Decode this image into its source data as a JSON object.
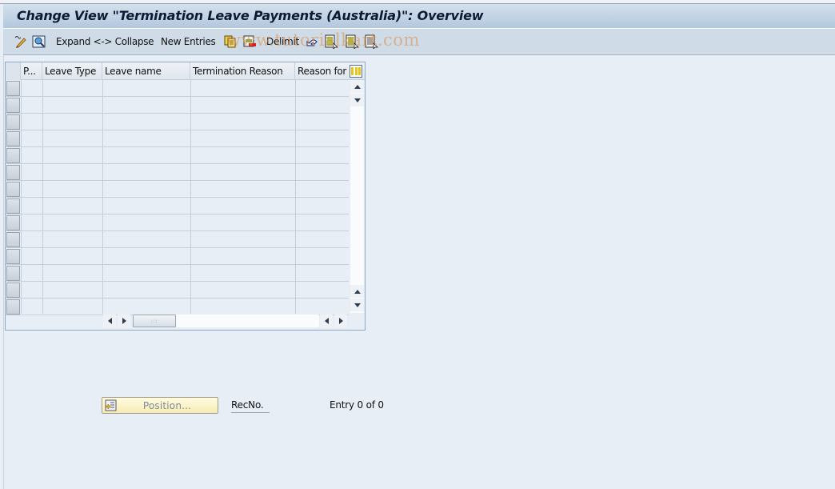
{
  "window": {
    "title": "Change View \"Termination Leave Payments (Australia)\": Overview"
  },
  "toolbar": {
    "items": [
      {
        "type": "icon",
        "name": "display-change-icon",
        "label": ""
      },
      {
        "type": "icon",
        "name": "find-icon",
        "label": ""
      },
      {
        "type": "text",
        "name": "expand-collapse-button",
        "label": "Expand <-> Collapse"
      },
      {
        "type": "text",
        "name": "new-entries-button",
        "label": "New Entries"
      },
      {
        "type": "icon",
        "name": "copy-as-icon",
        "label": ""
      },
      {
        "type": "icon",
        "name": "delete-icon",
        "label": ""
      },
      {
        "type": "text",
        "name": "delimit-button",
        "label": "Delimit"
      },
      {
        "type": "icon",
        "name": "undo-change-icon",
        "label": ""
      },
      {
        "type": "icon",
        "name": "select-all-icon",
        "label": ""
      },
      {
        "type": "icon",
        "name": "select-block-icon",
        "label": ""
      },
      {
        "type": "icon",
        "name": "deselect-all-icon",
        "label": ""
      }
    ],
    "watermark": "www.tutorialkart.com"
  },
  "table": {
    "columns": [
      {
        "key": "p",
        "label": "P..."
      },
      {
        "key": "leave_type",
        "label": "Leave Type"
      },
      {
        "key": "leave_name",
        "label": "Leave name"
      },
      {
        "key": "termination_reason",
        "label": "Termination Reason"
      },
      {
        "key": "reason_for",
        "label": "Reason for a"
      }
    ],
    "rows": [
      {
        "p": "",
        "leave_type": "",
        "leave_name": "",
        "termination_reason": "",
        "reason_for": ""
      },
      {
        "p": "",
        "leave_type": "",
        "leave_name": "",
        "termination_reason": "",
        "reason_for": ""
      },
      {
        "p": "",
        "leave_type": "",
        "leave_name": "",
        "termination_reason": "",
        "reason_for": ""
      },
      {
        "p": "",
        "leave_type": "",
        "leave_name": "",
        "termination_reason": "",
        "reason_for": ""
      },
      {
        "p": "",
        "leave_type": "",
        "leave_name": "",
        "termination_reason": "",
        "reason_for": ""
      },
      {
        "p": "",
        "leave_type": "",
        "leave_name": "",
        "termination_reason": "",
        "reason_for": ""
      },
      {
        "p": "",
        "leave_type": "",
        "leave_name": "",
        "termination_reason": "",
        "reason_for": ""
      },
      {
        "p": "",
        "leave_type": "",
        "leave_name": "",
        "termination_reason": "",
        "reason_for": ""
      },
      {
        "p": "",
        "leave_type": "",
        "leave_name": "",
        "termination_reason": "",
        "reason_for": ""
      },
      {
        "p": "",
        "leave_type": "",
        "leave_name": "",
        "termination_reason": "",
        "reason_for": ""
      },
      {
        "p": "",
        "leave_type": "",
        "leave_name": "",
        "termination_reason": "",
        "reason_for": ""
      },
      {
        "p": "",
        "leave_type": "",
        "leave_name": "",
        "termination_reason": "",
        "reason_for": ""
      },
      {
        "p": "",
        "leave_type": "",
        "leave_name": "",
        "termination_reason": "",
        "reason_for": ""
      },
      {
        "p": "",
        "leave_type": "",
        "leave_name": "",
        "termination_reason": "",
        "reason_for": ""
      }
    ],
    "column_config_icon": "table-settings-icon",
    "hscroll_thumb": ":::"
  },
  "footer": {
    "position_button": "Position...",
    "recno_label": "RecNo.",
    "entry_status": "Entry 0 of 0"
  },
  "colors": {
    "title_bar": "#b2c7de",
    "toolbar": "#cfdce7",
    "background": "#e8eef6",
    "position_button": "#f7ecb5"
  }
}
